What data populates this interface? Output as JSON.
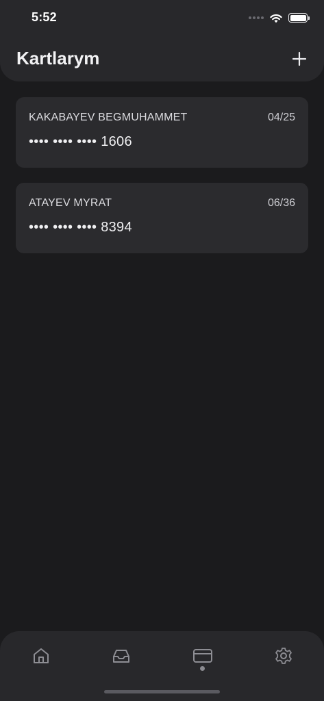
{
  "status_bar": {
    "time": "5:52"
  },
  "header": {
    "title": "Kartlarym",
    "add_icon": "plus-icon"
  },
  "cards": [
    {
      "holder": "KAKABAYEV BEGMUHAMMET",
      "expiry": "04/25",
      "number": "•••• •••• •••• 1606"
    },
    {
      "holder": "ATAYEV MYRAT",
      "expiry": "06/36",
      "number": "•••• •••• •••• 8394"
    }
  ],
  "tabbar": {
    "tabs": [
      {
        "icon": "home-icon",
        "active": false
      },
      {
        "icon": "inbox-icon",
        "active": false
      },
      {
        "icon": "credit-card-icon",
        "active": true
      },
      {
        "icon": "gear-icon",
        "active": false
      }
    ]
  },
  "colors": {
    "background": "#1b1b1d",
    "surface": "#28282b",
    "card": "#2b2b2e",
    "icon": "#8e8e94"
  }
}
